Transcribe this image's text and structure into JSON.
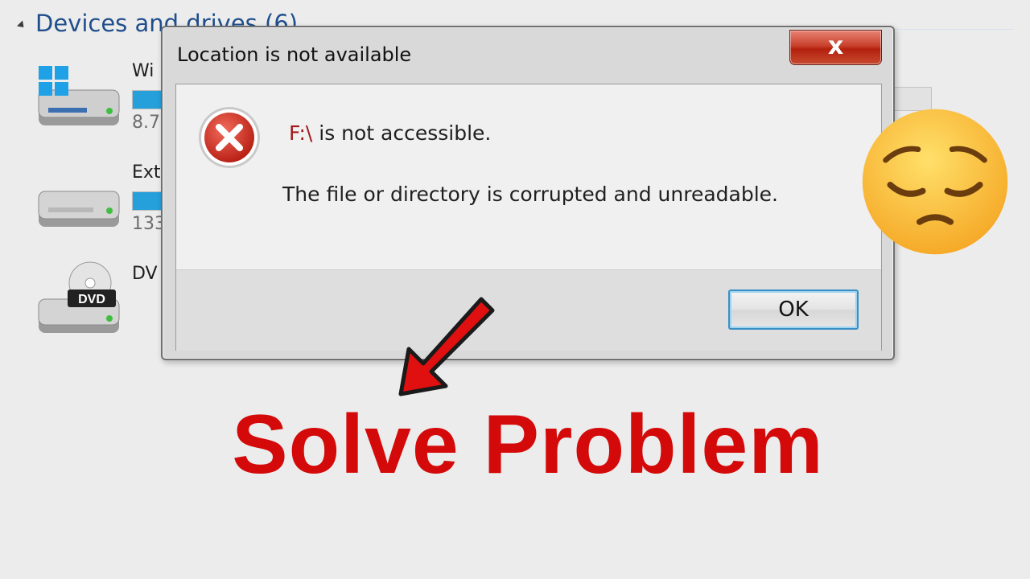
{
  "explorer": {
    "section_title": "Devices and drives (6)",
    "drives": [
      {
        "name": "Wi",
        "size": "8.7",
        "usage": 0.9
      },
      {
        "name": "Ext",
        "size": "133",
        "usage": 0.6
      },
      {
        "name": "DV",
        "size": "",
        "badge": "DVD"
      }
    ]
  },
  "dialog": {
    "title": "Location is not available",
    "close_label": "x",
    "message_drive": "F:\\",
    "message_main": " is not accessible.",
    "message_detail": "The file or directory is corrupted and unreadable.",
    "ok_label": "OK"
  },
  "overlay": {
    "headline": "Solve Problem",
    "emoji": "pensive-face"
  },
  "colors": {
    "headline": "#d40a0a",
    "link_blue": "#1f4e8c",
    "close_red": "#c42b1c",
    "ok_border": "#3c8fc4"
  }
}
